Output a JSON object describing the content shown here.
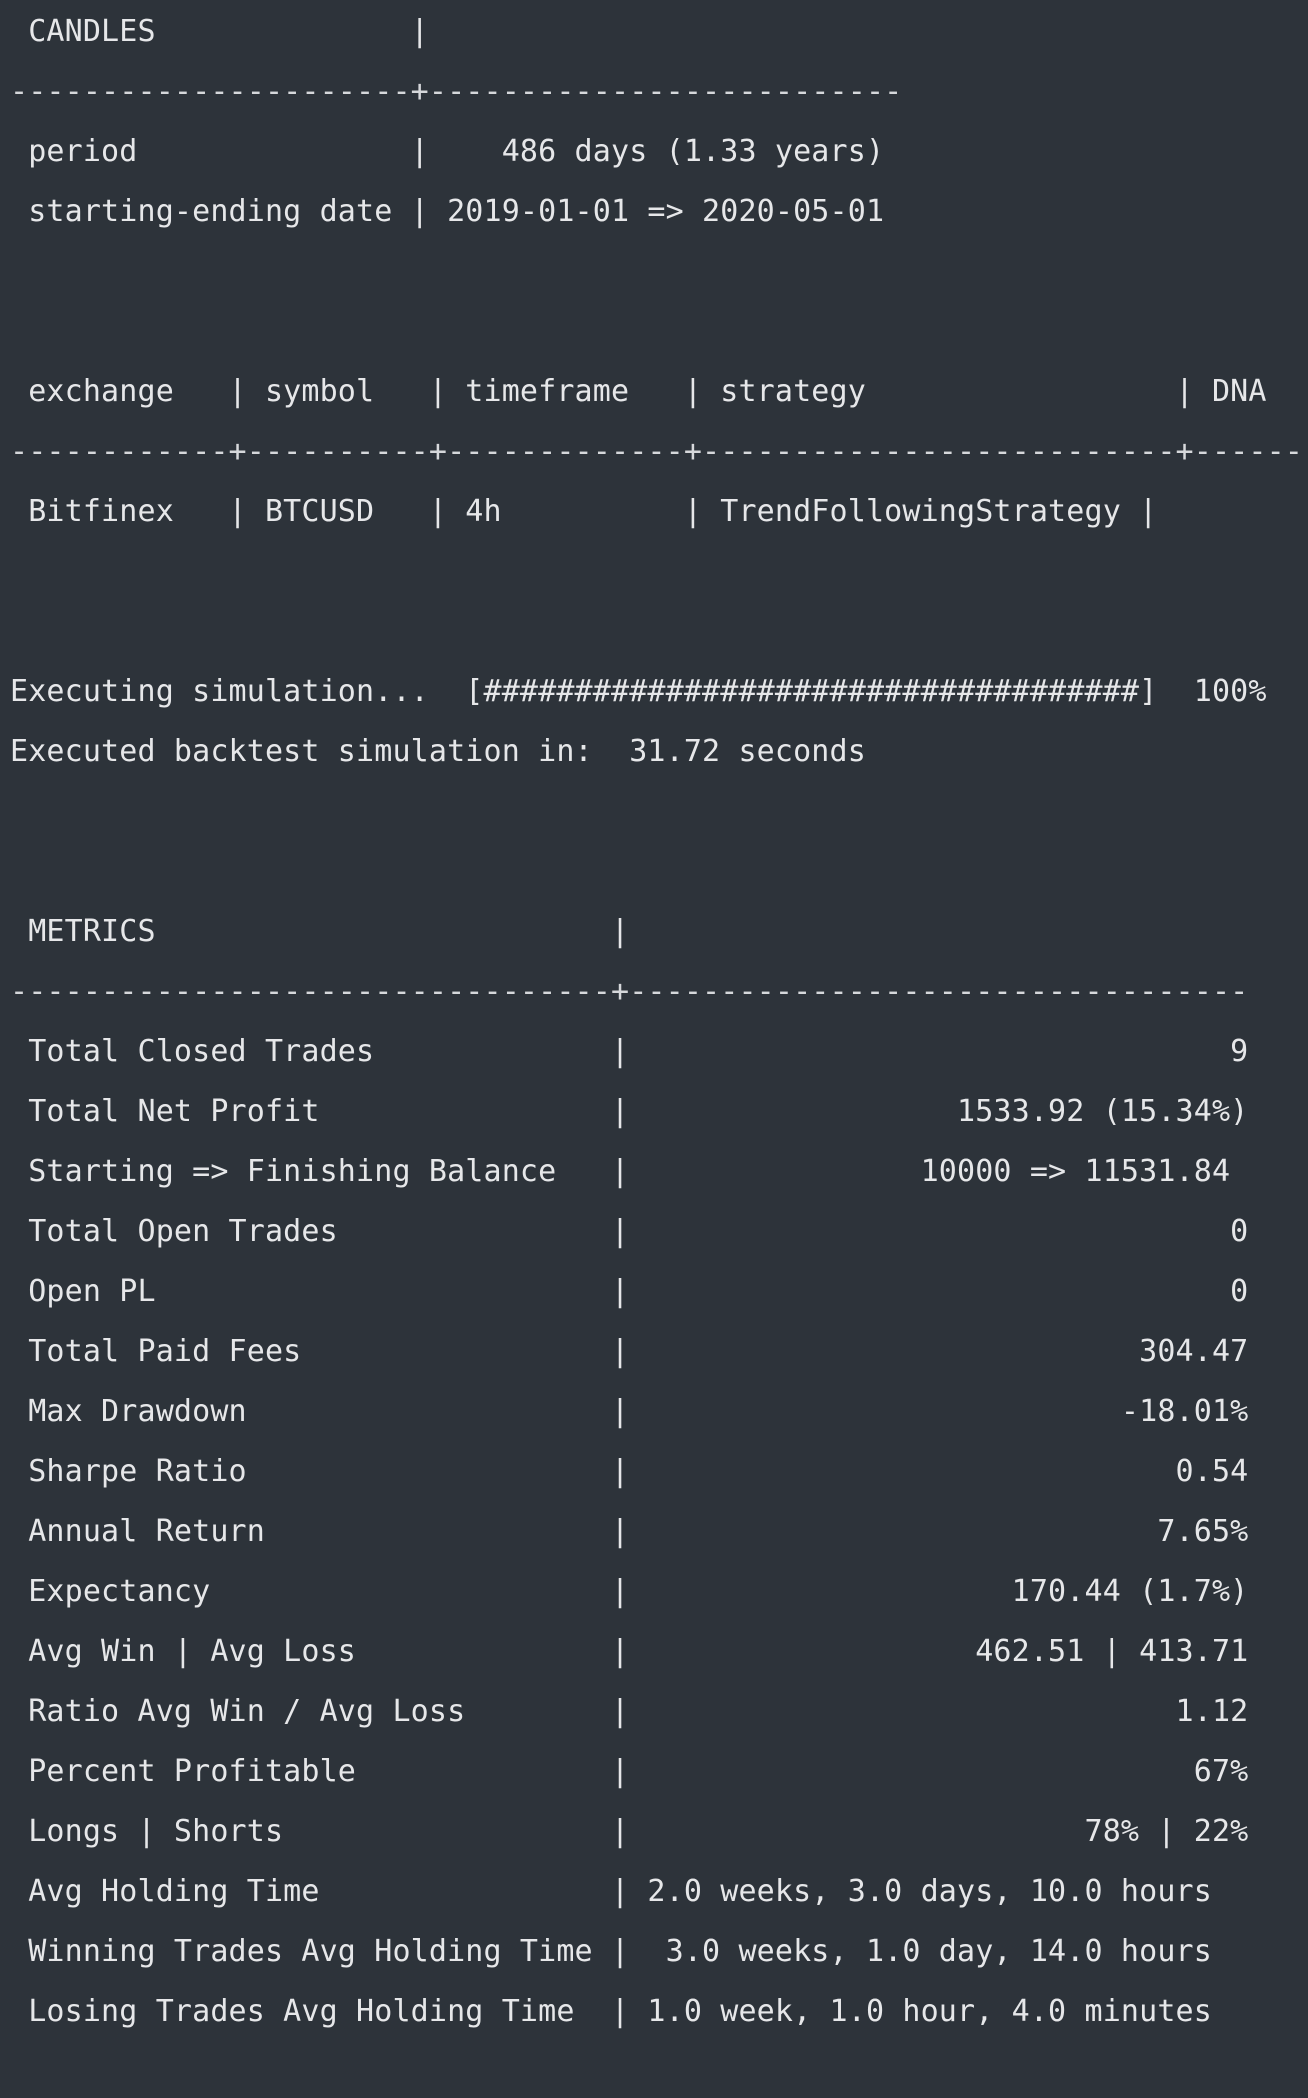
{
  "candles_table": {
    "header": " CANDLES              |",
    "divider": "----------------------+--------------------------",
    "rows": [
      " period               |    486 days (1.33 years)",
      " starting-ending date | 2019-01-01 => 2020-05-01"
    ]
  },
  "routes_table": {
    "header": " exchange   | symbol   | timeframe   | strategy                 | DNA",
    "divider": "------------+----------+-------------+--------------------------+-------",
    "rows": [
      " Bitfinex   | BTCUSD   | 4h          | TrendFollowingStrategy |"
    ]
  },
  "simulation": {
    "progress_line": "Executing simulation...  [####################################]  100%",
    "progress_percent": 100,
    "executed_line": "Executed backtest simulation in:  31.72 seconds"
  },
  "metrics_table": {
    "header": " METRICS                         |",
    "divider": "---------------------------------+----------------------------------",
    "rows": [
      " Total Closed Trades             |                                 9",
      " Total Net Profit                |                  1533.92 (15.34%)",
      " Starting => Finishing Balance   |                10000 => 11531.84",
      " Total Open Trades               |                                 0",
      " Open PL                         |                                 0",
      " Total Paid Fees                 |                            304.47",
      " Max Drawdown                    |                           -18.01%",
      " Sharpe Ratio                    |                              0.54",
      " Annual Return                   |                             7.65%",
      " Expectancy                      |                     170.44 (1.7%)",
      " Avg Win | Avg Loss              |                   462.51 | 413.71",
      " Ratio Avg Win / Avg Loss        |                              1.12",
      " Percent Profitable              |                               67%",
      " Longs | Shorts                  |                         78% | 22%",
      " Avg Holding Time                | 2.0 weeks, 3.0 days, 10.0 hours",
      " Winning Trades Avg Holding Time |  3.0 weeks, 1.0 day, 14.0 hours",
      " Losing Trades Avg Holding Time  | 1.0 week, 1.0 hour, 4.0 minutes"
    ]
  }
}
